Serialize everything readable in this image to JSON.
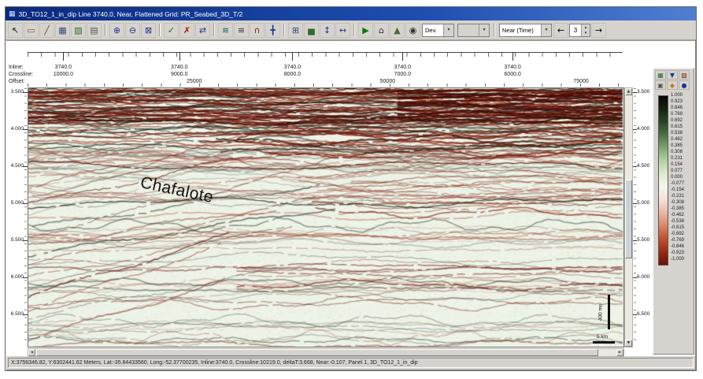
{
  "window": {
    "title": "3D_TO12_1_in_dip Line 3740.0, Near, Flattened Grid: PR_Seabed_3D_T/2",
    "title_icon": "▦"
  },
  "toolbar": {
    "icons": [
      {
        "name": "pointer",
        "glyph": "↖",
        "color": "#111111"
      },
      {
        "name": "eraser",
        "glyph": "▭",
        "color": "#8a5a2a"
      },
      {
        "name": "ruler",
        "glyph": "╱",
        "color": "#6b4a1a"
      },
      {
        "name": "table",
        "glyph": "▦",
        "color": "#33497a"
      },
      {
        "name": "paint",
        "glyph": "▨",
        "color": "#2e6b2e"
      },
      {
        "name": "print",
        "glyph": "▤",
        "color": "#555555"
      },
      {
        "sep": true
      },
      {
        "name": "zoom-in",
        "glyph": "⊕",
        "color": "#1a3a8a"
      },
      {
        "name": "zoom-out",
        "glyph": "⊖",
        "color": "#1a3a8a"
      },
      {
        "name": "zoom-box",
        "glyph": "⊠",
        "color": "#1a3a8a"
      },
      {
        "sep": true
      },
      {
        "name": "apply-check",
        "glyph": "✓",
        "color": "#0a7a0a"
      },
      {
        "name": "delete-cross",
        "glyph": "✗",
        "color": "#aa1100"
      },
      {
        "name": "swap",
        "glyph": "⇄",
        "color": "#1a3a8a"
      },
      {
        "sep": true
      },
      {
        "name": "wiggle",
        "glyph": "≋",
        "color": "#0a5a5a"
      },
      {
        "name": "flatten",
        "glyph": "≡",
        "color": "#333333"
      },
      {
        "name": "horizon",
        "glyph": "∩",
        "color": "#7a1a0a"
      },
      {
        "name": "crosshair",
        "glyph": "╋",
        "color": "#1a3a8a"
      },
      {
        "sep": true
      },
      {
        "name": "grid",
        "glyph": "⊞",
        "color": "#33497a"
      },
      {
        "name": "histogram",
        "glyph": "▅",
        "color": "#2e6b2e"
      },
      {
        "name": "vertical-scale",
        "glyph": "↕",
        "color": "#1a3a8a"
      },
      {
        "name": "horizontal-scale",
        "glyph": "↔",
        "color": "#1a3a8a"
      },
      {
        "sep": true
      },
      {
        "name": "play",
        "glyph": "▶",
        "color": "#0a7a0a"
      },
      {
        "name": "home",
        "glyph": "⌂",
        "color": "#333333"
      },
      {
        "name": "terrain",
        "glyph": "▲",
        "color": "#4a6a3a"
      },
      {
        "name": "snapshot",
        "glyph": "◉",
        "color": "#333333"
      }
    ],
    "dev_dropdown_label": "Dev.",
    "domain_dropdown_label": "Near (Time)",
    "combo_arrow_glyph": "▼",
    "step_value": "3",
    "spinner_up_glyph": "▲",
    "spinner_down_glyph": "▼",
    "back_arrow": "←",
    "forward_arrow": "→"
  },
  "axes": {
    "inline_label": "Inline:",
    "crossline_label": "Crossline:",
    "offset_label": "Offset:",
    "inline_values": [
      "3740.0",
      "3740.0",
      "3740.0",
      "3740.0",
      "3740.0"
    ],
    "crossline_values": [
      "10000.0",
      "9000.0",
      "8000.0",
      "7000.0",
      "6000.0"
    ],
    "offset_values": [
      "25000",
      "50000",
      "75000"
    ],
    "time_labels": [
      "3.500",
      "4.000",
      "4.500",
      "5.000",
      "5.500",
      "6.000",
      "6.500"
    ]
  },
  "seismic": {
    "annotation": "Chafalote",
    "scale_vertical": "400 ms",
    "scale_horizontal": "5 km"
  },
  "scrollbar": {
    "up": "▲",
    "down": "▼",
    "left": "◄",
    "right": "►"
  },
  "colorbar": {
    "values": [
      "1.000",
      "0.923",
      "0.846",
      "0.769",
      "0.692",
      "0.615",
      "0.538",
      "0.462",
      "0.385",
      "0.308",
      "0.231",
      "0.154",
      "0.077",
      "0.000",
      "-0.077",
      "-0.154",
      "-0.231",
      "-0.308",
      "-0.385",
      "-0.462",
      "-0.538",
      "-0.615",
      "-0.692",
      "-0.769",
      "-0.846",
      "-0.923",
      "-1.000"
    ],
    "gradient": [
      "#060606",
      "#142310",
      "#2c4527",
      "#4f7046",
      "#7fa671",
      "#b3d2a4",
      "#dcead0",
      "#f4f6ee",
      "#f3e0d8",
      "#e9b6a5",
      "#d98467",
      "#c14f33",
      "#9a2a15",
      "#6b1206"
    ],
    "tools": [
      {
        "name": "colorbar-palette",
        "glyph": "▦",
        "color": "#2e6b2e"
      },
      {
        "name": "colorbar-save",
        "glyph": "▼",
        "color": "#1a3a8a"
      },
      {
        "name": "colorbar-edit",
        "glyph": "▧",
        "color": "#7a1a0a"
      },
      {
        "name": "colorbar-lock",
        "glyph": "▣",
        "color": "#555555"
      },
      {
        "name": "colorbar-up",
        "glyph": "◆",
        "color": "#b8860b"
      },
      {
        "name": "colorbar-reset",
        "glyph": "●",
        "color": "#1a3a8a"
      }
    ]
  },
  "statusbar": {
    "text": "X:3756346.82, Y:6302441.62 Meters, Lat:-35.84433560, Long:-52.37700235,  Inline:3740.0, Crossline:10219.0, deltaT:3.668, Near:-0.107, Panel 1,  3D_TO12_1_in_dip"
  }
}
